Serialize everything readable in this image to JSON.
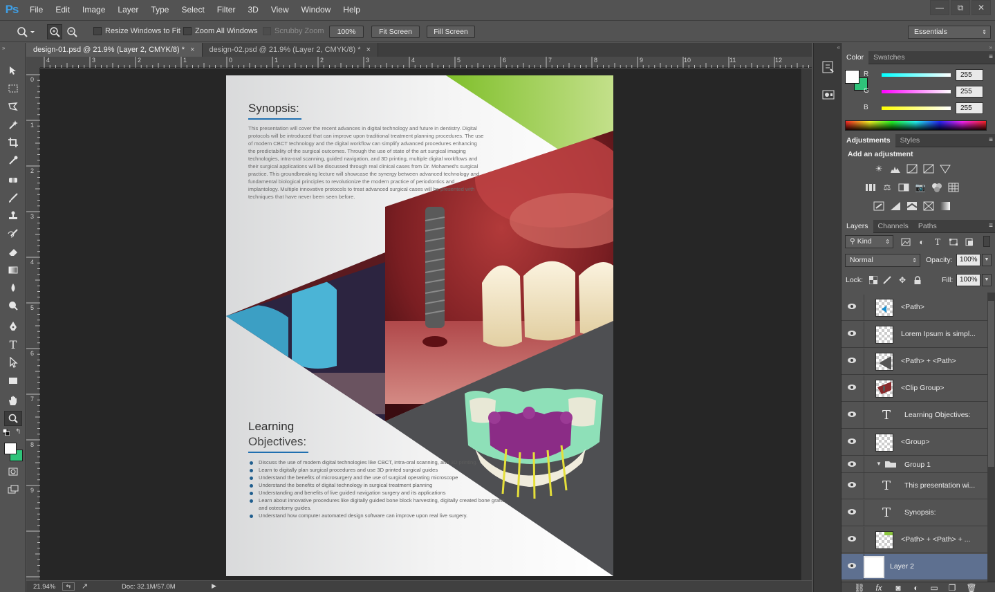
{
  "app": {
    "logo": "Ps"
  },
  "menu": [
    "File",
    "Edit",
    "Image",
    "Layer",
    "Type",
    "Select",
    "Filter",
    "3D",
    "View",
    "Window",
    "Help"
  ],
  "window_controls": {
    "minimize": "—",
    "restore": "⧉",
    "close": "✕"
  },
  "options_bar": {
    "resize_windows": "Resize Windows to Fit",
    "zoom_all": "Zoom All Windows",
    "scrubby_zoom": "Scrubby Zoom",
    "zoom_100": "100%",
    "fit_screen": "Fit Screen",
    "fill_screen": "Fill Screen",
    "workspace": "Essentials"
  },
  "tabs": [
    {
      "label": "design-01.psd @ 21.9% (Layer 2, CMYK/8) *",
      "close": "×",
      "active": true
    },
    {
      "label": "design-02.psd @ 21.9% (Layer 2, CMYK/8) *",
      "close": "×",
      "active": false
    }
  ],
  "ruler": {
    "h_labels": [
      "4",
      "3",
      "2",
      "1",
      "0",
      "1",
      "2",
      "3",
      "4",
      "5",
      "6",
      "7",
      "8",
      "9",
      "10",
      "11",
      "12"
    ],
    "v_labels": [
      "0",
      "1",
      "2",
      "3",
      "4",
      "5",
      "6",
      "7",
      "8",
      "9"
    ]
  },
  "status": {
    "zoom": "21.94%",
    "doc": "Doc: 32.1M/57.0M"
  },
  "document": {
    "synopsis_title": "Synopsis:",
    "synopsis_text": "This presentation will cover the recent advances in digital technology and future in dentistry. Digital protocols will be introduced that can improve upon traditional treatment planning procedures. The use of modern CBCT technology and the digital workflow can simplify advanced procedures enhancing the predictability of the surgical outcomes. Through the use of state of the art surgical imaging technologies, intra-oral scanning, guided navigation, and 3D printing, multiple digital workflows and their surgical applications will be discussed through real clinical cases from Dr. Mohamed's surgical practice. This groundbreaking lecture will showcase the synergy between advanced technology and fundamental biological principles to revolutionize the modern practice of periodontics and implantology. Multiple innovative protocols to treat advanced surgical cases will be presented with techniques that have never been seen before.",
    "objectives_title_1": "Learning",
    "objectives_title_2": "Objectives:",
    "objectives": [
      "Discuss the use of modern digital technologies like CBCT, intra-oral scanning, and 3D printing.",
      "Learn to digitally plan surgical procedures and use 3D printed surgical guides",
      "Understand the benefits of microsurgery and the use of surgical operating microscope",
      "Understand the benefits of digital technology in surgical treatment planning",
      "Understanding and benefits of live guided navigation surgery and its applications",
      "Learn about innovative procedures like digitally guided bone block harvesting, digitally created bone grafts, and osteotomy guides.",
      "Understand how computer automated design software can improve upon real live surgery."
    ]
  },
  "color_panel": {
    "tabs": [
      "Color",
      "Swatches"
    ],
    "channels": [
      {
        "label": "R",
        "value": "255",
        "gradient": "#00e5e5"
      },
      {
        "label": "G",
        "value": "255",
        "gradient": "#ff00ff"
      },
      {
        "label": "B",
        "value": "255",
        "gradient": "#ffff00"
      }
    ],
    "foreground": "#ffffff",
    "background": "#2ec47a"
  },
  "adjustments_panel": {
    "tabs": [
      "Adjustments",
      "Styles"
    ],
    "title": "Add an adjustment"
  },
  "layers_panel": {
    "tabs": [
      "Layers",
      "Channels",
      "Paths"
    ],
    "filter": "Kind",
    "blend_mode": "Normal",
    "opacity_label": "Opacity:",
    "opacity": "100%",
    "lock_label": "Lock:",
    "fill_label": "Fill:",
    "fill": "100%",
    "layers": [
      {
        "name": "<Path>",
        "kind": "path-blue"
      },
      {
        "name": "Lorem Ipsum is simpl...",
        "kind": "empty"
      },
      {
        "name": "<Path> + <Path>",
        "kind": "path-gray"
      },
      {
        "name": "<Clip Group>",
        "kind": "photo"
      },
      {
        "name": "Learning  Objectives:",
        "kind": "text"
      },
      {
        "name": "<Group>",
        "kind": "empty"
      },
      {
        "name": "Group 1",
        "kind": "folder"
      },
      {
        "name": "This presentation wi...",
        "kind": "text"
      },
      {
        "name": "Synopsis:",
        "kind": "text"
      },
      {
        "name": "<Path> + <Path> + ...",
        "kind": "green"
      },
      {
        "name": "Layer 2",
        "kind": "white",
        "selected": true
      }
    ]
  }
}
